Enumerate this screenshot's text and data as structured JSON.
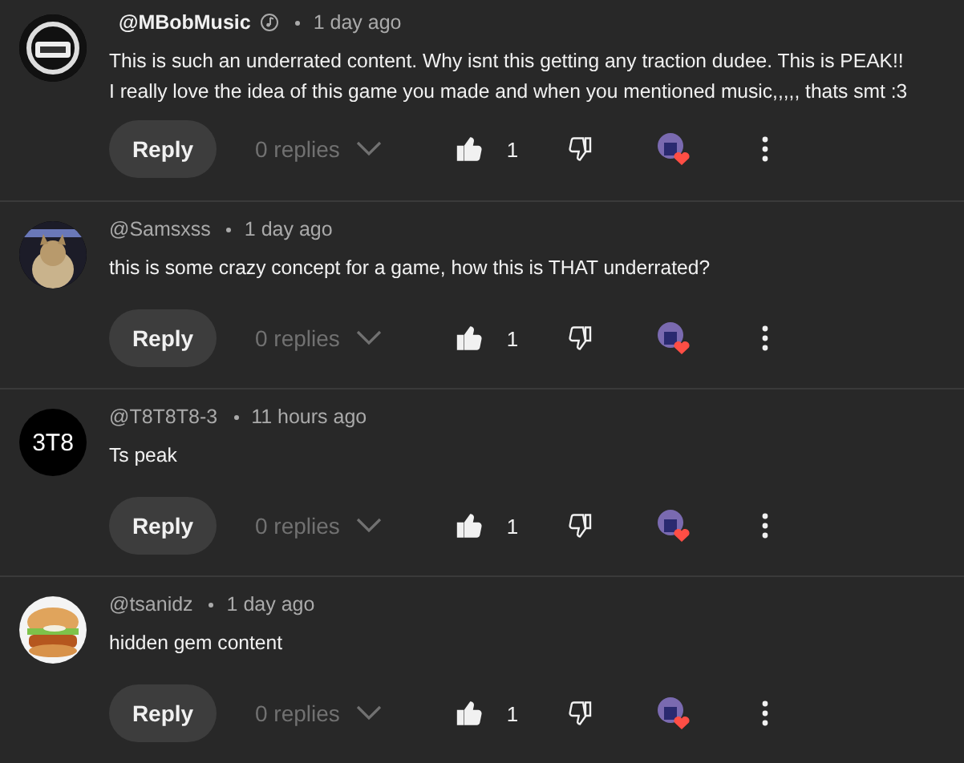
{
  "comments": [
    {
      "avatar": {
        "kind": "picture"
      },
      "author": "@MBobMusic",
      "is_creator": true,
      "time": "1 day ago",
      "lines": [
        "This is such an underrated content. Why isnt this getting any traction dudee. This is PEAK!!",
        "I really love the idea of this game you made and when you mentioned music,,,,, thats smt :3"
      ],
      "reply_label": "Reply",
      "replies": "0 replies",
      "likes": "1",
      "liked": true,
      "hearted": true
    },
    {
      "avatar": {
        "kind": "picture"
      },
      "author": "@Samsxss",
      "is_creator": false,
      "time": "1 day ago",
      "lines": [
        "this is some crazy concept for a game, how this is THAT underrated?"
      ],
      "reply_label": "Reply",
      "replies": "0 replies",
      "likes": "1",
      "liked": true,
      "hearted": true
    },
    {
      "avatar": {
        "kind": "initials",
        "text": "3T8"
      },
      "author": "@T8T8T8-3",
      "is_creator": false,
      "time": "11 hours ago",
      "lines": [
        "Ts peak"
      ],
      "reply_label": "Reply",
      "replies": "0 replies",
      "likes": "1",
      "liked": true,
      "hearted": true
    },
    {
      "avatar": {
        "kind": "picture"
      },
      "author": "@tsanidz",
      "is_creator": false,
      "time": "1 day ago",
      "lines": [
        "hidden gem content"
      ],
      "reply_label": "Reply",
      "replies": "0 replies",
      "likes": "1",
      "liked": true,
      "hearted": true
    }
  ]
}
